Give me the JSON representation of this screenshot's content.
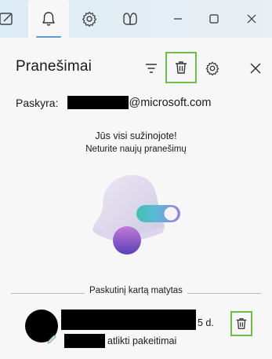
{
  "tabs": [
    {
      "name": "tab-contacts",
      "icon": "contact-card-icon",
      "active": false
    },
    {
      "name": "tab-notifications",
      "icon": "bell-icon",
      "active": true
    },
    {
      "name": "tab-settings",
      "icon": "gear-icon",
      "active": false
    },
    {
      "name": "tab-copilot",
      "icon": "copilot-icon",
      "active": false
    }
  ],
  "window_controls": [
    "minimize-icon",
    "maximize-icon",
    "close-icon"
  ],
  "panel": {
    "title": "Pranešimai",
    "actions": [
      "filter-icon",
      "trash-icon",
      "gear-icon",
      "close-icon"
    ]
  },
  "account": {
    "label": "Paskyra:",
    "email_domain": "@microsoft.com"
  },
  "empty_state": {
    "heading": "Jūs visi sužinojote!",
    "subtext": "Neturite naujų pranešimų"
  },
  "history": {
    "divider_label": "Paskutinį kartą matytas",
    "items": [
      {
        "time": "5 d.",
        "action_text": "atlikti pakeitimai"
      }
    ]
  },
  "colors": {
    "highlight": "#6cc04a",
    "accent": "#5a9bd5"
  }
}
